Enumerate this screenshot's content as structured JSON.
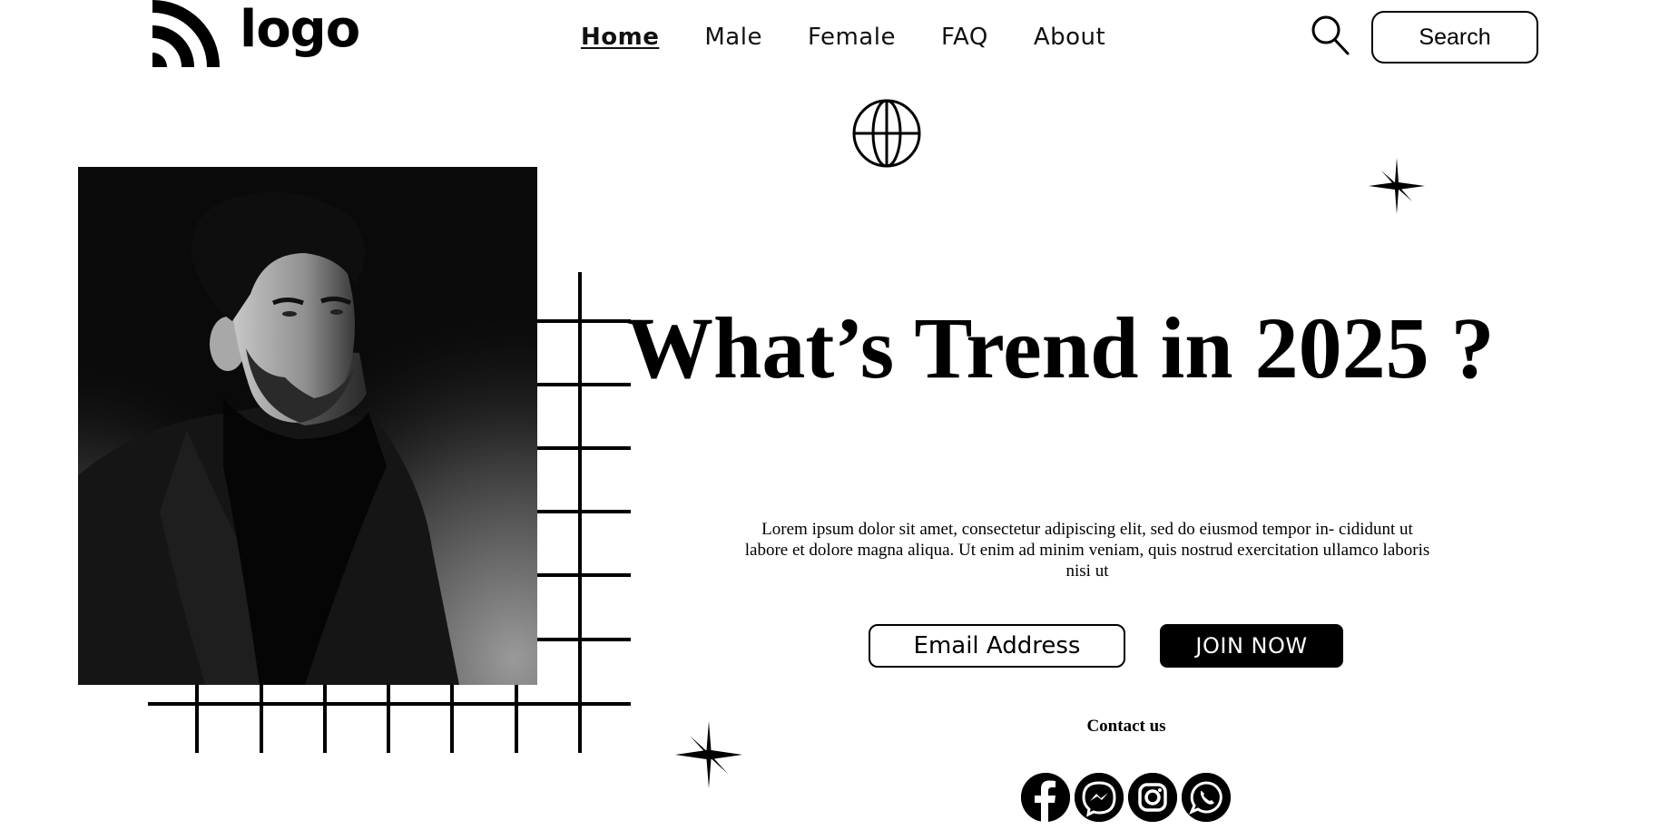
{
  "logo": {
    "text": "logo",
    "icon": "signal-waves-icon"
  },
  "nav": {
    "items": [
      {
        "label": "Home",
        "active": true
      },
      {
        "label": "Male"
      },
      {
        "label": "Female"
      },
      {
        "label": "FAQ"
      },
      {
        "label": "About"
      }
    ]
  },
  "search": {
    "icon": "search-icon",
    "button_label": "Search"
  },
  "hero": {
    "title": "What’s Trend in 2025 ?",
    "description": "Lorem ipsum dolor sit amet, consectetur adipiscing elit, sed do eiusmod tempor in- cididunt ut labore et dolore magna aliqua. Ut enim ad minim veniam, quis nostrud exercitation ullamco laboris nisi ut"
  },
  "subscribe": {
    "email_placeholder": "Email Address",
    "join_label": "JOIN NOW"
  },
  "contact": {
    "title": "Contact us",
    "socials": [
      "facebook-icon",
      "messenger-icon",
      "instagram-icon",
      "whatsapp-icon"
    ]
  },
  "colors": {
    "text": "#000000",
    "background": "#ffffff",
    "button": "#000000"
  }
}
